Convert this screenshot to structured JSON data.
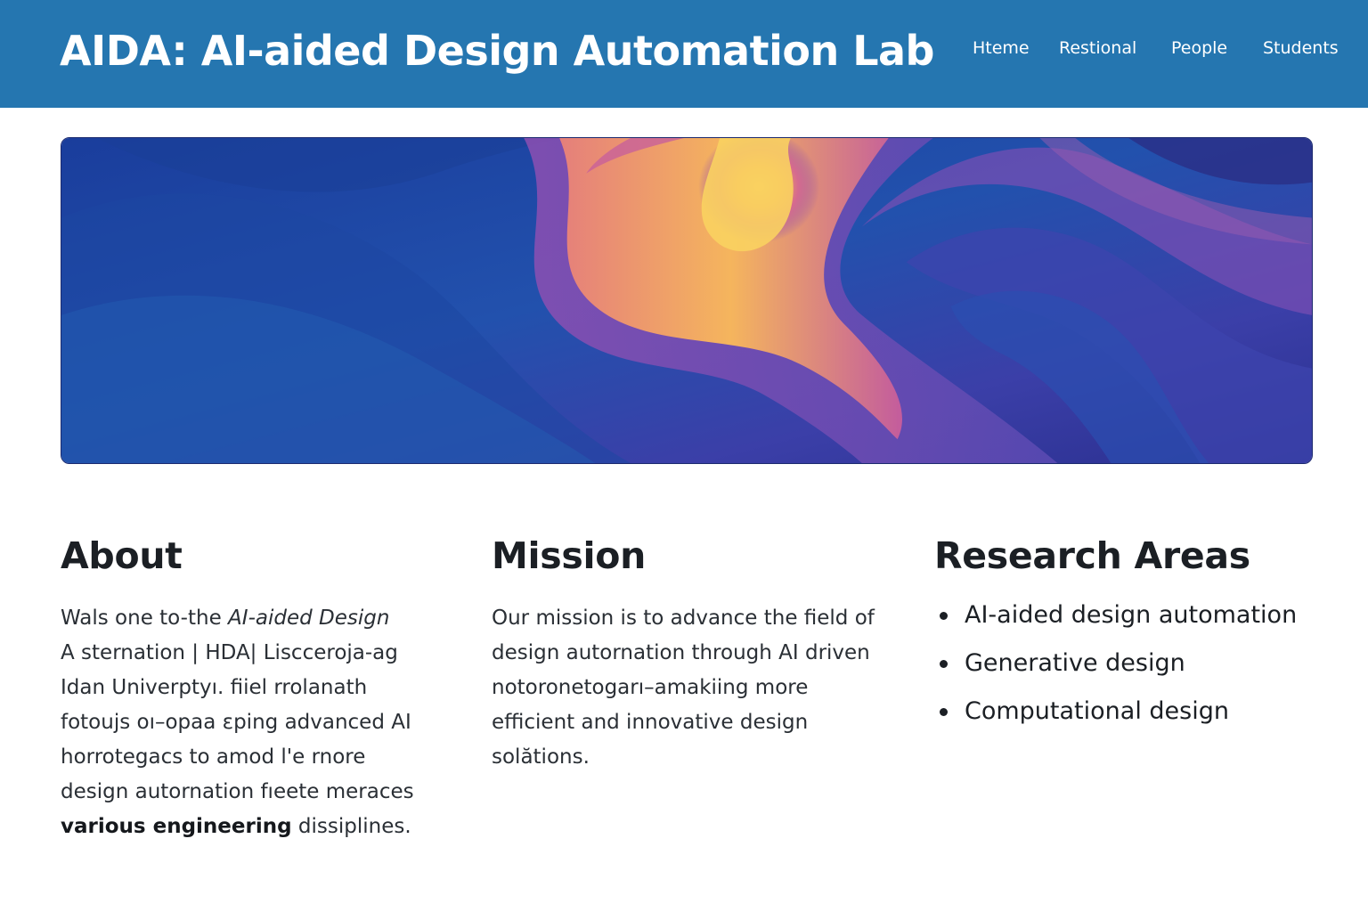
{
  "header": {
    "title": "AIDA: AI-aided Design Automation Lab",
    "nav": [
      "Hteme",
      "Restional",
      "People",
      "Students"
    ]
  },
  "colors": {
    "header_bg": "#2576b0",
    "hero_blue": "#1f49a8",
    "hero_orange": "#f3a35a",
    "hero_yellow": "#f8c95a",
    "hero_purple": "#8a4fb0"
  },
  "about": {
    "heading": "About",
    "lines": [
      {
        "prefix": "Wals one to-the ",
        "italic": "AI-aided Design"
      },
      {
        "text": "A sternation | HDA|  Liscceroja-ag"
      },
      {
        "text": "Idan Univerptyı. fiiel   rrolanath"
      },
      {
        "text": "fotoujs oı–opaa εping advanced AI"
      },
      {
        "text": "horrotegacs to amod l'e rnore"
      },
      {
        "text": "design autornation fıeete meraces"
      },
      {
        "bold": "various engineering",
        "suffix": " dissiplines."
      }
    ]
  },
  "mission": {
    "heading": "Mission",
    "lines": [
      "Our mission is to advance the field of",
      "design autornation through AI driven",
      "notoronetogarı–amakiing more",
      "efficient and innovative design",
      "solătions."
    ]
  },
  "research": {
    "heading": "Research Areas",
    "items": [
      "AI-aided design automation",
      "Generative design",
      "Computational design"
    ]
  }
}
